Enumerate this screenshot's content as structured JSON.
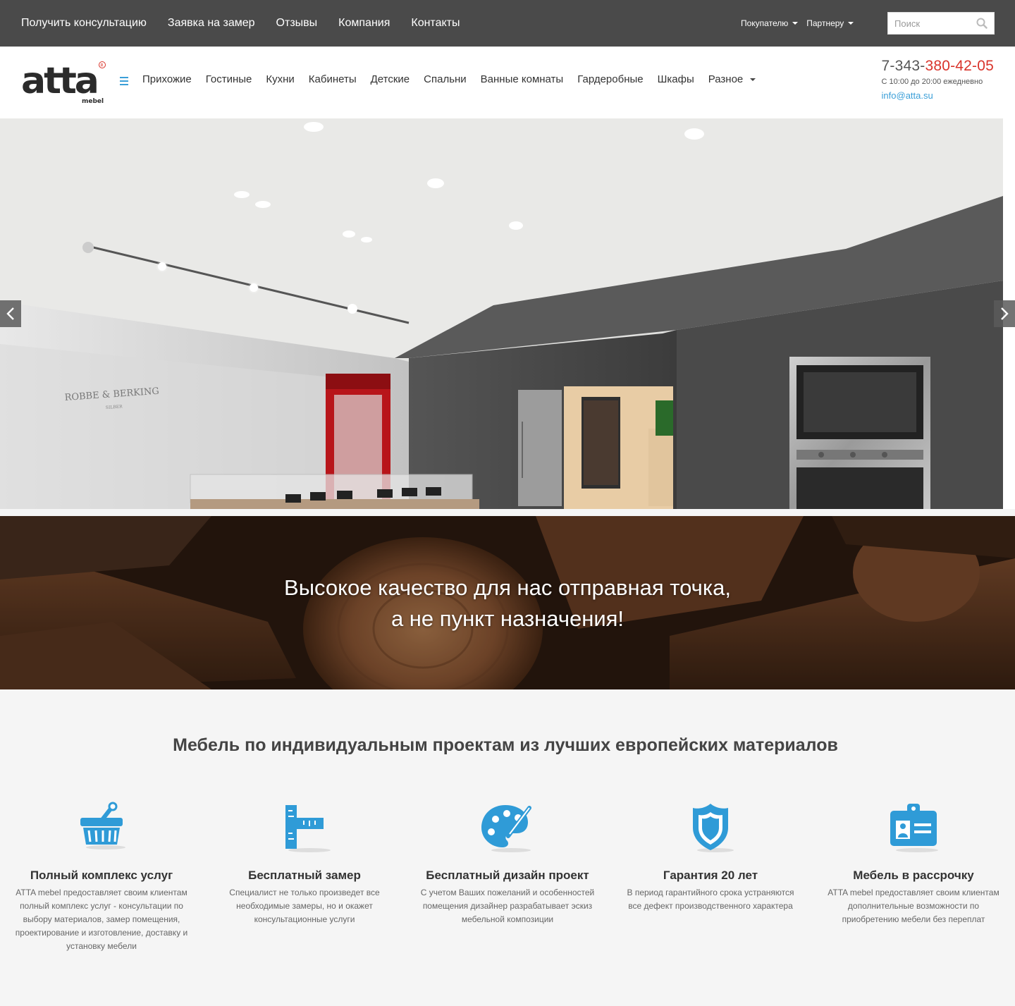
{
  "topbar": {
    "nav": [
      "Получить консультацию",
      "Заявка на замер",
      "Отзывы",
      "Компания",
      "Контакты"
    ],
    "buyer": "Покупателю",
    "partner": "Партнеру",
    "search_placeholder": "Поиск"
  },
  "header": {
    "logo_text": "atta",
    "logo_sub": "mebel",
    "nav": [
      "Прихожие",
      "Гостиные",
      "Кухни",
      "Кабинеты",
      "Детские",
      "Спальни",
      "Ванные комнаты",
      "Гардеробные",
      "Шкафы",
      "Разное"
    ],
    "phone_prefix": "7-343-",
    "phone_number": "380-42-05",
    "hours": "С 10:00 до 20:00 ежедневно",
    "email": "info@atta.su"
  },
  "slider": {
    "brand_sign": "ROBBE & BERKING",
    "brand_sub": "SILBER"
  },
  "banner": {
    "line1": "Высокое качество для нас отправная точка,",
    "line2": "а не пункт назначения!"
  },
  "features": {
    "title": "Мебель по индивидуальным проектам из лучших европейских материалов",
    "items": [
      {
        "icon": "basket-icon",
        "title": "Полный комплекс услуг",
        "text": "ATTA mebel предоставляет своим клиентам полный комплекс услуг - консультации по выбору материалов, замер помещения, проектирование и изготовление, доставку и установку мебели"
      },
      {
        "icon": "ruler-icon",
        "title": "Бесплатный замер",
        "text": "Специалист не только произведет все необходимые замеры, но и окажет консультационные услуги"
      },
      {
        "icon": "palette-icon",
        "title": "Бесплатный дизайн проект",
        "text": "С учетом Ваших пожеланий и особенностей помещения дизайнер разрабатывает эскиз мебельной композиции"
      },
      {
        "icon": "shield-icon",
        "title": "Гарантия 20 лет",
        "text": "В период гарантийного срока устраняются все дефект производственного характера"
      },
      {
        "icon": "id-card-icon",
        "title": "Мебель в рассрочку",
        "text": "ATTA mebel предоставляет своим клиентам дополнительные возможности по приобретению мебели без переплат"
      }
    ]
  },
  "colors": {
    "topbar": "#4a4a4a",
    "accent_blue": "#3b9fd8",
    "phone_red": "#d9342b"
  }
}
